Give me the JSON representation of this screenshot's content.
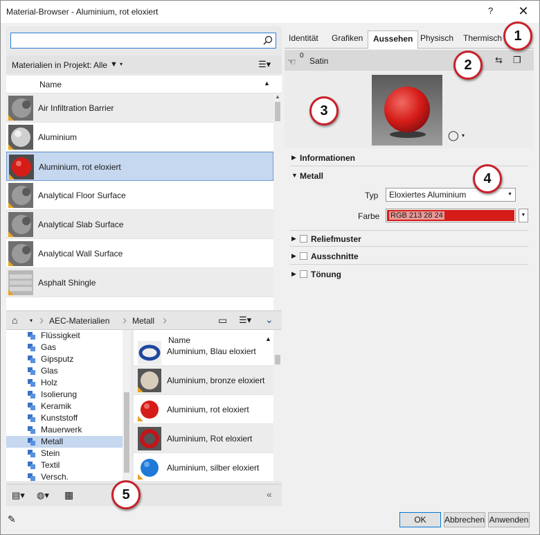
{
  "window": {
    "title": "Material-Browser - Aluminium, rot eloxiert",
    "help": "?",
    "close": "✕"
  },
  "search": {
    "value": "",
    "placeholder": ""
  },
  "filter": {
    "label": "Materialien in Projekt: Alle"
  },
  "list": {
    "header": "Name",
    "items": [
      {
        "label": "Air Infiltration Barrier",
        "thumb": "gray-sphere"
      },
      {
        "label": "Aluminium",
        "thumb": "silver-sphere"
      },
      {
        "label": "Aluminium, rot eloxiert",
        "thumb": "red-sphere",
        "selected": true
      },
      {
        "label": "Analytical Floor Surface",
        "thumb": "gray-sphere"
      },
      {
        "label": "Analytical Slab Surface",
        "thumb": "gray-sphere"
      },
      {
        "label": "Analytical Wall Surface",
        "thumb": "gray-sphere"
      },
      {
        "label": "Asphalt Shingle",
        "thumb": "shingle"
      }
    ]
  },
  "breadcrumb": {
    "items": [
      "AEC-Materialien",
      "Metall"
    ]
  },
  "tree": {
    "items": [
      "Flüssigkeit",
      "Gas",
      "Gipsputz",
      "Glas",
      "Holz",
      "Isolierung",
      "Keramik",
      "Kunststoff",
      "Mauerwerk",
      "Metall",
      "Stein",
      "Textil",
      "Versch."
    ],
    "selected": "Metall"
  },
  "library": {
    "header": "Name",
    "items": [
      {
        "label": "Aluminium, Blau eloxiert",
        "thumb": "blue-ring"
      },
      {
        "label": "Aluminium, bronze eloxiert",
        "thumb": "bronze-sphere"
      },
      {
        "label": "Aluminium, rot eloxiert",
        "thumb": "red-sphere"
      },
      {
        "label": "Aluminium, Rot eloxiert",
        "thumb": "red-ring"
      },
      {
        "label": "Aluminium, silber eloxiert",
        "thumb": "blue-sphere"
      }
    ]
  },
  "tabs": [
    "Identität",
    "Grafiken",
    "Aussehen",
    "Physisch",
    "Thermisch"
  ],
  "active_tab": "Aussehen",
  "asset": {
    "count": "0",
    "name": "Satin"
  },
  "sections": {
    "informationen": "Informationen",
    "metall": "Metall",
    "reliefmuster": "Reliefmuster",
    "ausschnitte": "Ausschnitte",
    "toenung": "Tönung"
  },
  "properties": {
    "typ_label": "Typ",
    "typ_value": "Eloxiertes Aluminium",
    "farbe_label": "Farbe",
    "farbe_value": "RGB 213 28 24"
  },
  "buttons": {
    "ok": "OK",
    "cancel": "Abbrechen",
    "apply": "Anwenden"
  },
  "callouts": [
    "1",
    "2",
    "3",
    "4",
    "5"
  ],
  "colors": {
    "accent": "#2a7fd4",
    "selection": "#c6d8ef",
    "material_red": "#d51c18",
    "callout_border": "#c8202a"
  }
}
